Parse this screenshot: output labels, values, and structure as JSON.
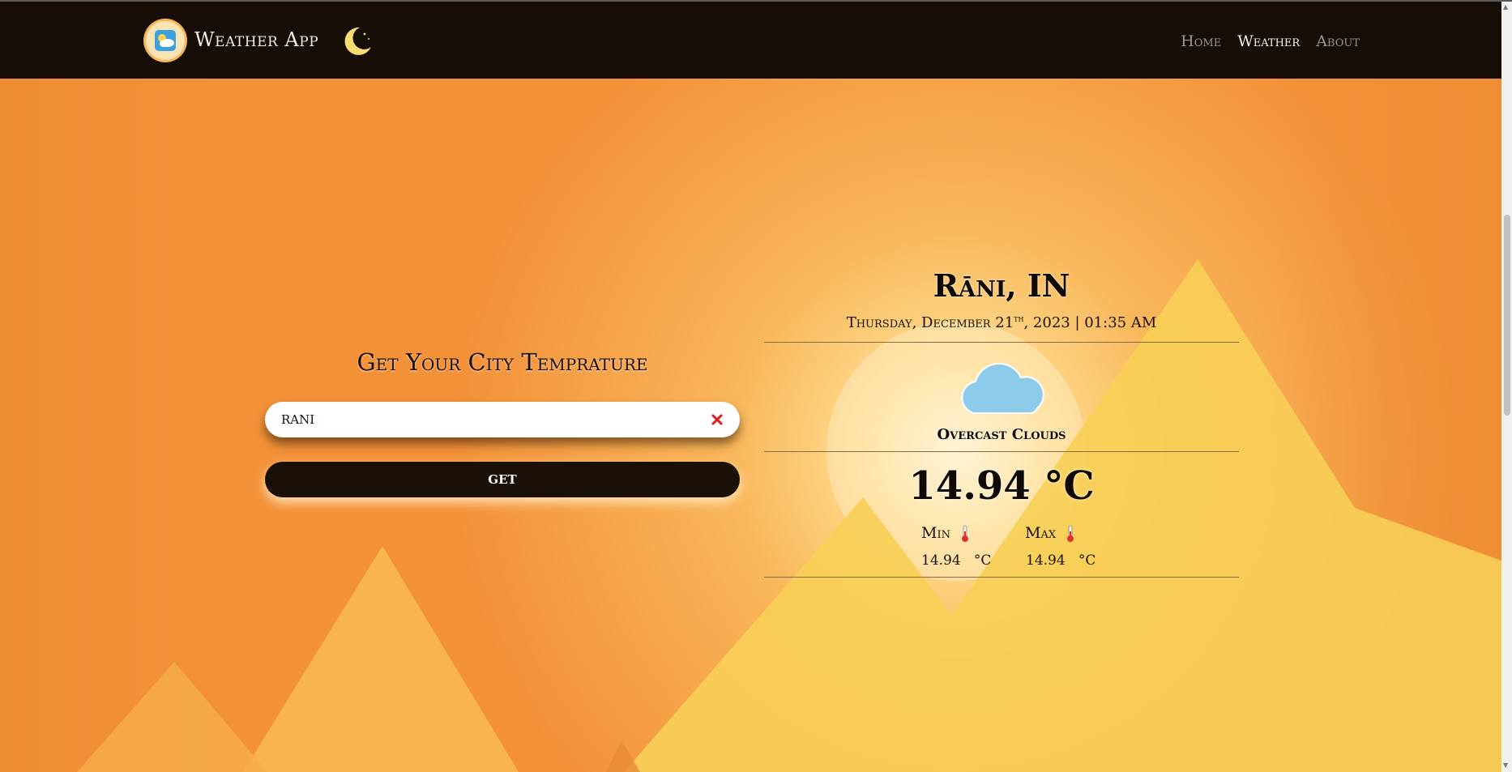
{
  "navbar": {
    "brand": "Weather App",
    "links": [
      {
        "label": "Home"
      },
      {
        "label": "Weather"
      },
      {
        "label": "About"
      }
    ],
    "active_link": "Weather"
  },
  "search": {
    "title": "Get Your City Temprature",
    "value": "RANI",
    "button_label": "GET"
  },
  "weather": {
    "city": "Rāni, IN",
    "day_date": "Thursday, December 21",
    "ordinal": "th",
    "year_time": ", 2023 | 01:35 AM",
    "condition": "Overcast Clouds",
    "temperature": "14.94 °C",
    "min_label": "Min",
    "max_label": "Max",
    "min_value": "14.94   °C",
    "max_value": "14.94   °C"
  },
  "colors": {
    "navbar": "#160e06",
    "background": "#f59a3e",
    "mountain": "#f7c94f",
    "button": "#1a1008",
    "clear_icon": "#e01818",
    "cloud": "#8ccbea"
  },
  "icons": {
    "logo": "weather-logo-icon",
    "theme_toggle": "moon-icon",
    "clear": "close-icon",
    "condition": "cloud-icon",
    "min": "thermometer-icon",
    "max": "thermometer-icon"
  }
}
